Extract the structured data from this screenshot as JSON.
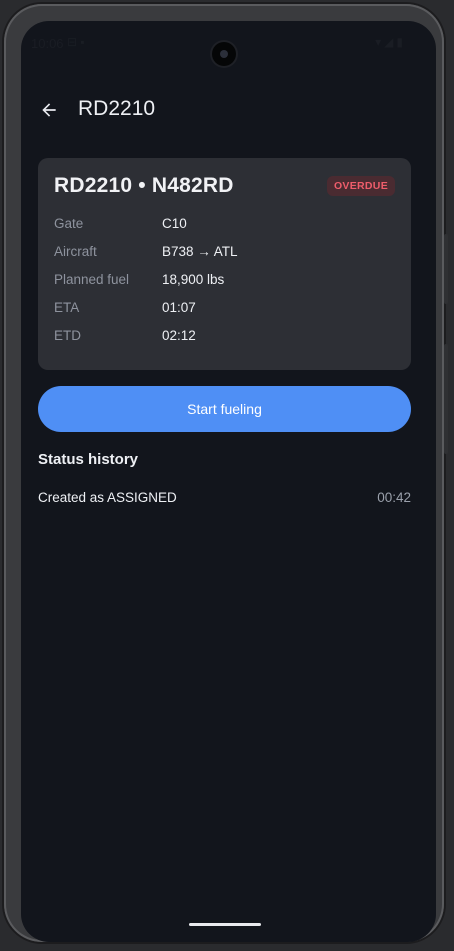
{
  "status_bar": {
    "time": "10:06",
    "left_icons": "⊟ ▪",
    "right_icons": "▾◢▮"
  },
  "app_bar": {
    "title": "RD2210",
    "back_icon": "arrow-left"
  },
  "card": {
    "header": "RD2210 • N482RD",
    "badge": "OVERDUE",
    "rows": [
      {
        "label": "Gate",
        "value": "C10"
      },
      {
        "label": "Aircraft",
        "value": "B738 → ATL"
      },
      {
        "label": "Planned fuel",
        "value": "18,900 lbs"
      },
      {
        "label": "ETA",
        "value": "01:07"
      },
      {
        "label": "ETD",
        "value": "02:12"
      }
    ]
  },
  "primary_button": {
    "label": "Start fueling"
  },
  "status_history": {
    "title": "Status history",
    "items": [
      {
        "text": "Created as ASSIGNED",
        "time": "00:42"
      }
    ]
  },
  "colors": {
    "accent": "#4f8ff5",
    "overdue": "#ee5d6b",
    "background": "#12151c",
    "card": "#2d2f35"
  }
}
